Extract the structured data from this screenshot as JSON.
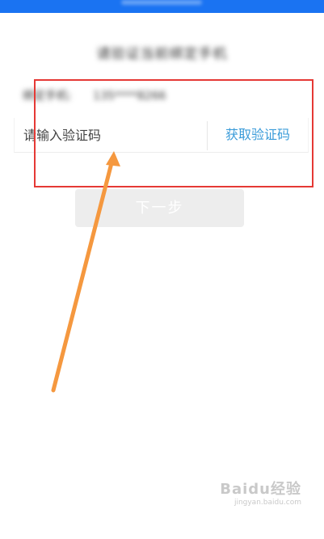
{
  "header": {
    "title": ""
  },
  "instruction": {
    "text": "请验证当前绑定手机"
  },
  "phone": {
    "label": "绑定手机:",
    "value": "135****8266"
  },
  "code": {
    "placeholder": "请输入验证码",
    "get_code_label": "获取验证码"
  },
  "next_button": {
    "label": "下一步"
  },
  "watermark": {
    "logo": "Baidu经验",
    "url": "jingyan.baidu.com"
  },
  "colors": {
    "topbar": "#1a73f2",
    "link": "#3a9bd9",
    "highlight": "#e53935",
    "arrow": "#f5983f",
    "disabled_button": "#ededed"
  },
  "icons": {
    "annotation": "arrow-annotation-icon"
  }
}
